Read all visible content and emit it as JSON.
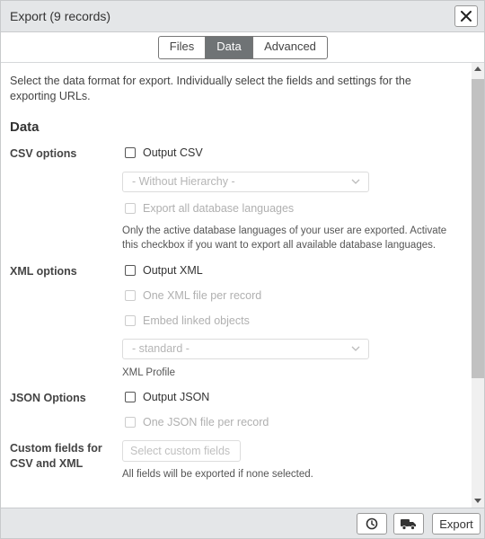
{
  "window": {
    "title": "Export (9 records)"
  },
  "tabs": [
    {
      "label": "Files",
      "active": false
    },
    {
      "label": "Data",
      "active": true
    },
    {
      "label": "Advanced",
      "active": false
    }
  ],
  "content": {
    "intro": "Select the data format for export. Individually select the fields and settings for the exporting URLs.",
    "section_title": "Data",
    "csv": {
      "label": "CSV options",
      "output_label": "Output CSV",
      "hierarchy_select": "- Without Hierarchy -",
      "all_languages_label": "Export all database languages",
      "languages_note": "Only the active database languages of your user are exported. Activate this checkbox if you want to export all available database languages."
    },
    "xml": {
      "label": "XML options",
      "output_label": "Output XML",
      "one_file_label": "One XML file per record",
      "embed_label": "Embed linked objects",
      "profile_select": "- standard -",
      "profile_caption": "XML Profile"
    },
    "json": {
      "label": "JSON Options",
      "output_label": "Output JSON",
      "one_file_label": "One JSON file per record"
    },
    "custom_fields": {
      "label_line1": "Custom fields for",
      "label_line2": "CSV and XML",
      "button_label": "Select custom fields",
      "note": "All fields will be exported if none selected."
    }
  },
  "footer": {
    "export_label": "Export"
  },
  "icons": {
    "close": "close-icon",
    "history": "clock-icon",
    "transport": "truck-icon",
    "select_arrow": "chevron-down-icon"
  },
  "colors": {
    "active_tab": "#6f7375",
    "titlebar": "#e4e6e8"
  }
}
